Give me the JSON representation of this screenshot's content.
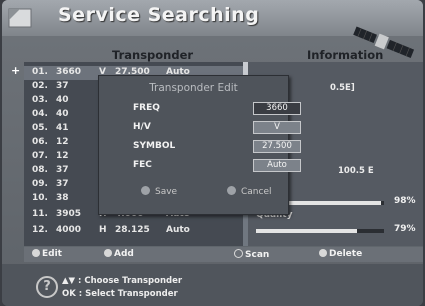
{
  "header": {
    "title": "Service Searching"
  },
  "columns": {
    "transponder": "Transponder",
    "information": "Information"
  },
  "list": {
    "marker": "+",
    "rows": [
      {
        "no": "01.",
        "freq": "3660",
        "pol": "V",
        "sym": "27.500",
        "fec": "Auto"
      },
      {
        "no": "02.",
        "freq": "37",
        "pol": "",
        "sym": "",
        "fec": ""
      },
      {
        "no": "03.",
        "freq": "40",
        "pol": "",
        "sym": "",
        "fec": ""
      },
      {
        "no": "04.",
        "freq": "40",
        "pol": "",
        "sym": "",
        "fec": ""
      },
      {
        "no": "05.",
        "freq": "41",
        "pol": "",
        "sym": "",
        "fec": ""
      },
      {
        "no": "06.",
        "freq": "12",
        "pol": "",
        "sym": "",
        "fec": ""
      },
      {
        "no": "07.",
        "freq": "12",
        "pol": "",
        "sym": "",
        "fec": ""
      },
      {
        "no": "08.",
        "freq": "37",
        "pol": "",
        "sym": "",
        "fec": ""
      },
      {
        "no": "09.",
        "freq": "37",
        "pol": "",
        "sym": "",
        "fec": ""
      },
      {
        "no": "10.",
        "freq": "38",
        "pol": "",
        "sym": "",
        "fec": ""
      },
      {
        "no": "11.",
        "freq": "3905",
        "pol": "H",
        "sym": "4.000",
        "fec": "Auto"
      },
      {
        "no": "12.",
        "freq": "4000",
        "pol": "H",
        "sym": "28.125",
        "fec": "Auto"
      }
    ]
  },
  "info": {
    "satellite_text": "0.5E]",
    "position_text": "100.5 E",
    "quality_label": "Quality",
    "signal_strength_percent": 98,
    "signal_strength_text": "98%",
    "quality_percent": 79,
    "quality_text": "79%"
  },
  "legend": {
    "edit": "Edit",
    "add": "Add",
    "scan": "Scan",
    "delete": "Delete"
  },
  "help": {
    "line1": "▲▼ : Choose Transponder",
    "line2": "OK : Select Transponder"
  },
  "dialog": {
    "title": "Transponder Edit",
    "fields": {
      "freq_label": "FREQ",
      "freq_value": "3660",
      "hv_label": "H/V",
      "hv_value": "V",
      "symbol_label": "SYMBOL",
      "symbol_value": "27.500",
      "fec_label": "FEC",
      "fec_value": "Auto"
    },
    "save_label": "Save",
    "cancel_label": "Cancel"
  },
  "colors": {
    "accent": "#e4e4e4",
    "panel": "#454a52",
    "dialog": "#4f545b"
  }
}
